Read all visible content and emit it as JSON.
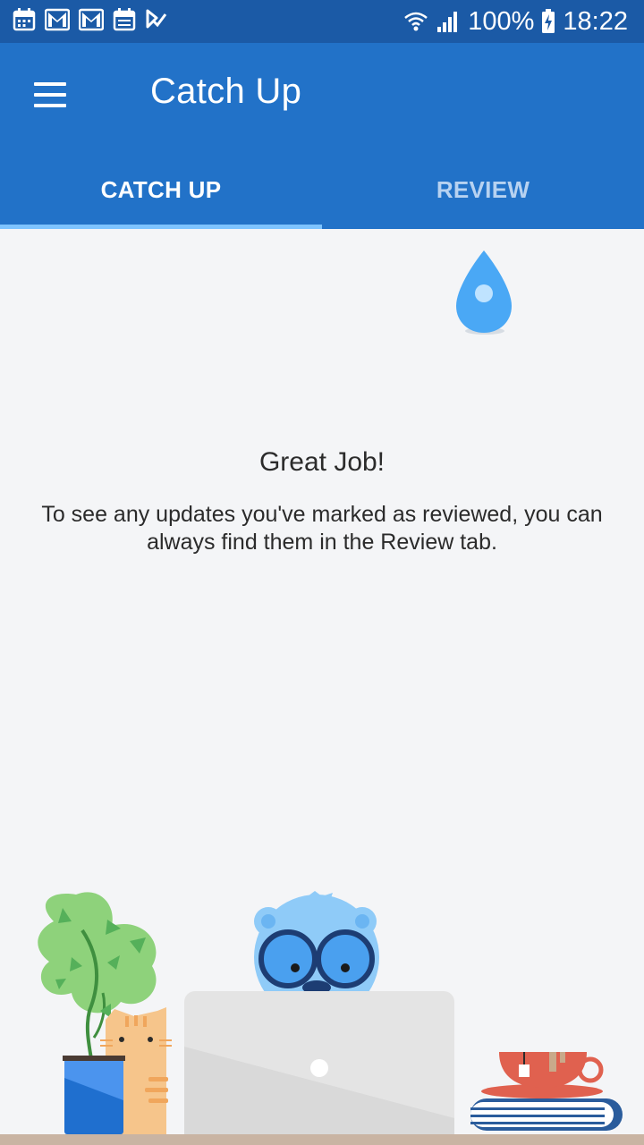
{
  "status_bar": {
    "notification_icons": [
      "calendar-icon",
      "gmail-icon",
      "gmail-icon",
      "calendar-icon",
      "check-icon"
    ],
    "wifi_icon": "wifi-icon",
    "signal_icon": "signal-icon",
    "battery_percent": "100%",
    "battery_icon": "battery-charging-icon",
    "time": "18:22"
  },
  "app_bar": {
    "menu_icon": "hamburger-menu-icon",
    "title": "Catch Up"
  },
  "tabs": [
    {
      "label": "CATCH UP",
      "selected": true
    },
    {
      "label": "REVIEW",
      "selected": false
    }
  ],
  "colors": {
    "status_bar": "#1b5aa6",
    "app_bar": "#2272c8",
    "tab_indicator": "#7dc3ff",
    "background": "#f4f5f7"
  },
  "empty_state": {
    "heading": "Great Job!",
    "body": "To see any updates you've marked as reviewed, you can always find them in the Review tab.",
    "illustration": "mascot-at-laptop-illustration"
  }
}
